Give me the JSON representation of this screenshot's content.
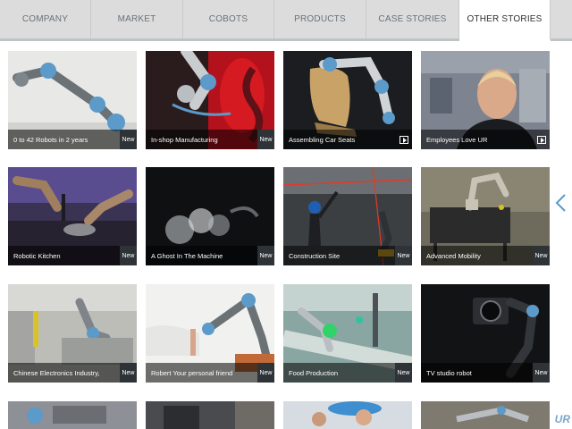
{
  "nav": {
    "tabs": [
      {
        "label": "COMPANY",
        "active": false
      },
      {
        "label": "MARKET",
        "active": false
      },
      {
        "label": "COBOTS",
        "active": false
      },
      {
        "label": "PRODUCTS",
        "active": false
      },
      {
        "label": "CASE STORIES",
        "active": false
      },
      {
        "label": "OTHER STORIES",
        "active": true
      }
    ]
  },
  "tiles": [
    {
      "caption": "0 to 42 Robots in 2 years",
      "badge": "New"
    },
    {
      "caption": "In-shop Manufacturing",
      "badge": "New"
    },
    {
      "caption": "Assembling Car Seats",
      "badge": "",
      "icon": "video-icon"
    },
    {
      "caption": "Employees Love UR",
      "badge": "",
      "icon": "video-icon"
    },
    {
      "caption": "Robotic Kitchen",
      "badge": "New"
    },
    {
      "caption": "A Ghost In The Machine",
      "badge": "New"
    },
    {
      "caption": "Construction Site",
      "badge": "New"
    },
    {
      "caption": "Advanced Mobility",
      "badge": "New"
    },
    {
      "caption": "Chinese Electronics Industry,",
      "badge": "New"
    },
    {
      "caption": "Robert Your personal friend",
      "badge": "New"
    },
    {
      "caption": "Food Production",
      "badge": "New"
    },
    {
      "caption": "TV studio robot",
      "badge": "New"
    }
  ],
  "logo": "UR",
  "colors": {
    "nav_bg": "#dcdcdc",
    "accent": "#5c9ac9",
    "badge_bg": "#2e3338"
  }
}
